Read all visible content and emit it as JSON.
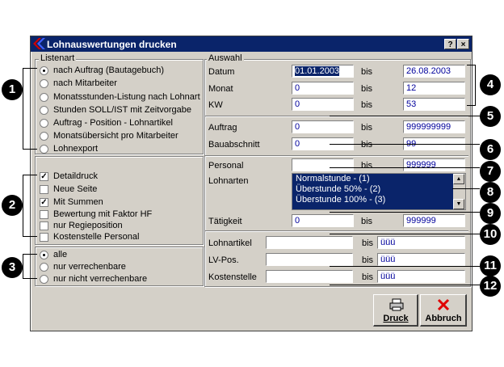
{
  "window": {
    "title": "Lohnauswertungen drucken",
    "help_btn": "?",
    "close_btn": "×"
  },
  "listenart": {
    "legend": "Listenart",
    "options": [
      "nach Auftrag (Bautagebuch)",
      "nach Mitarbeiter",
      "Monatsstunden-Listung nach Lohnart",
      "Stunden SOLL/IST mit Zeitvorgabe",
      "Auftrag - Position - Lohnartikel",
      "Monatsübersicht pro Mitarbeiter",
      "Lohnexport"
    ],
    "selected": 0
  },
  "options": {
    "items": [
      "Detaildruck",
      "Neue Seite",
      "Mit Summen",
      "Bewertung mit Faktor HF",
      "nur Regieposition",
      "Kostenstelle Personal"
    ],
    "checked": [
      true,
      false,
      true,
      false,
      false,
      false
    ]
  },
  "verrechnung": {
    "items": [
      "alle",
      "nur verrechenbare",
      "nur nicht verrechenbare"
    ],
    "selected": 0
  },
  "auswahl": {
    "legend": "Auswahl",
    "bis": "bis",
    "datum": {
      "label": "Datum",
      "from": "01.01.2003",
      "to": "26.08.2003"
    },
    "monat": {
      "label": "Monat",
      "from": "0",
      "to": "12"
    },
    "kw": {
      "label": "KW",
      "from": "0",
      "to": "53"
    },
    "auftrag": {
      "label": "Auftrag",
      "from": "0",
      "to": "999999999"
    },
    "bauabschnitt": {
      "label": "Bauabschnitt",
      "from": "0",
      "to": "99"
    },
    "personal": {
      "label": "Personal",
      "from": "",
      "to": "999999"
    },
    "lohnarten": {
      "label": "Lohnarten",
      "items": [
        "Normalstunde - (1)",
        "Überstunde 50% - (2)",
        "Überstunde 100% - (3)"
      ]
    },
    "taetigkeit": {
      "label": "Tätigkeit",
      "from": "0",
      "to": "999999"
    },
    "lohnartikel": {
      "label": "Lohnartikel",
      "from": "",
      "to": "üüü"
    },
    "lvpos": {
      "label": "LV-Pos.",
      "from": "",
      "to": "üüü"
    },
    "kostenstelle": {
      "label": "Kostenstelle",
      "from": "",
      "to": "üüü"
    }
  },
  "buttons": {
    "druck": "Druck",
    "abbruch": "Abbruch"
  },
  "callouts": [
    "1",
    "2",
    "3",
    "4",
    "5",
    "6",
    "7",
    "8",
    "9",
    "10",
    "11",
    "12"
  ]
}
